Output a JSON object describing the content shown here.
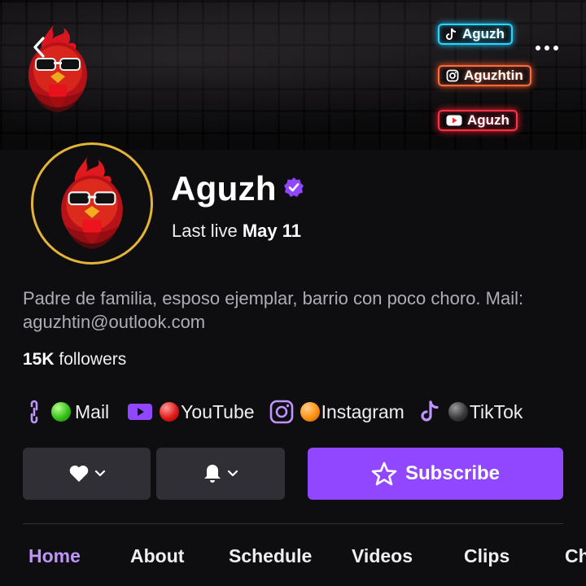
{
  "banner": {
    "tags": [
      {
        "platform": "tiktok",
        "icon": "tiktok-icon",
        "label": "Aguzh"
      },
      {
        "platform": "instagram",
        "icon": "instagram-icon",
        "label": "Aguzhtin"
      },
      {
        "platform": "youtube",
        "icon": "youtube-icon",
        "label": "Aguzh"
      }
    ]
  },
  "channel": {
    "name": "Aguzh",
    "verified_icon": "verified-badge-icon",
    "last_live_prefix": "Last live",
    "last_live_date": "May 11",
    "bio": "Padre de familia, esposo ejemplar, barrio con poco choro. Mail: aguzhtin@outlook.com",
    "followers_count": "15K",
    "followers_label": "followers"
  },
  "links": [
    {
      "icon": "link-icon",
      "emoji": "green-circle",
      "label": "Mail"
    },
    {
      "icon": "youtube-icon",
      "emoji": "red-circle",
      "label": "YouTube"
    },
    {
      "icon": "instagram-icon",
      "emoji": "orange-circle",
      "label": "Instagram"
    },
    {
      "icon": "tiktok-icon",
      "emoji": "black-circle",
      "label": "TikTok"
    }
  ],
  "actions": {
    "follow_icon": "heart-icon",
    "notify_icon": "bell-icon",
    "subscribe_label": "Subscribe"
  },
  "tabs": [
    {
      "label": "Home",
      "active": true
    },
    {
      "label": "About",
      "active": false
    },
    {
      "label": "Schedule",
      "active": false
    },
    {
      "label": "Videos",
      "active": false
    },
    {
      "label": "Clips",
      "active": false
    },
    {
      "label": "Chat",
      "active": false
    }
  ],
  "colors": {
    "accent": "#9147ff",
    "active_tab": "#bf94ff",
    "background": "#0e0e10",
    "button_bg": "#2f2f35",
    "avatar_ring": "#e3b33a"
  }
}
